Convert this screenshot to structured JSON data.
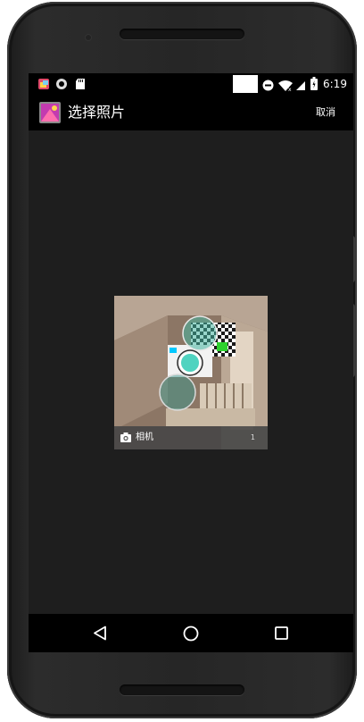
{
  "status_bar": {
    "time": "6:19",
    "left_icons": [
      "photo-app-notification-icon",
      "sync-circle-icon",
      "sd-card-icon"
    ],
    "right_icons": [
      "do-not-disturb-icon",
      "wifi-icon",
      "cell-signal-icon",
      "battery-icon"
    ]
  },
  "app_bar": {
    "title": "选择照片",
    "cancel_label": "取消",
    "app_icon": "gallery-app-icon"
  },
  "album": {
    "name": "相机",
    "count": "1",
    "icon": "camera-icon"
  },
  "nav_bar": {
    "icons": [
      "back-icon",
      "home-icon",
      "recents-icon"
    ]
  },
  "colors": {
    "background": "#1e1e1e",
    "bars": "#000000",
    "text": "#ffffff"
  }
}
